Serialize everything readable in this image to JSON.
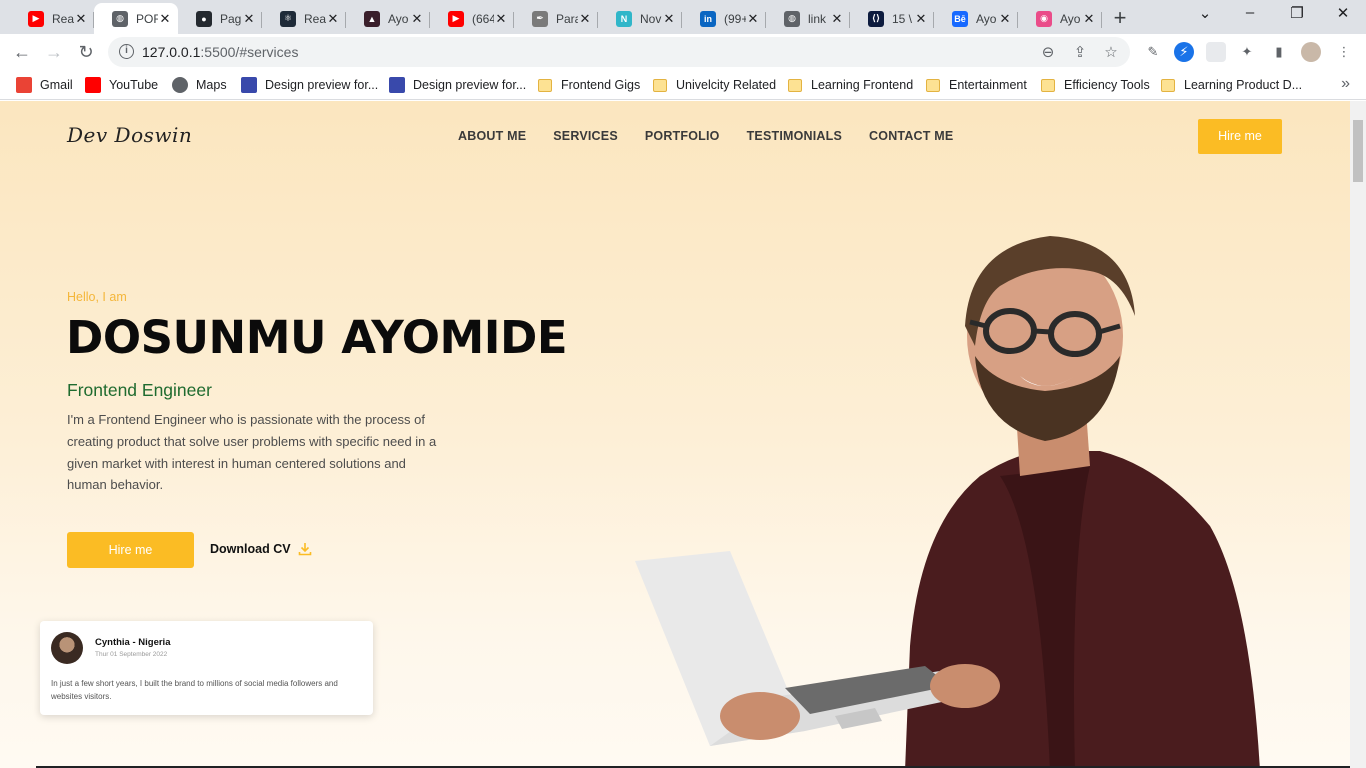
{
  "browser": {
    "tabs": [
      {
        "title": "Rea",
        "favicon": "youtube-icon",
        "color": "#ff0000"
      },
      {
        "title": "POF",
        "favicon": "globe-icon",
        "color": "#5f6368",
        "active": true
      },
      {
        "title": "Pag",
        "favicon": "github-icon",
        "color": "#24292f"
      },
      {
        "title": "Rea",
        "favicon": "react-icon",
        "color": "#1e2a38"
      },
      {
        "title": "Ayo",
        "favicon": "triangle-logo-icon",
        "color": "#3a1f2b"
      },
      {
        "title": "(664",
        "favicon": "youtube-icon",
        "color": "#ff0000"
      },
      {
        "title": "Para",
        "favicon": "feather-icon",
        "color": "#7a7a7a"
      },
      {
        "title": "Nov",
        "favicon": "n-logo-icon",
        "color": "#30b6c9"
      },
      {
        "title": "(99+",
        "favicon": "linkedin-icon",
        "color": "#0a66c2"
      },
      {
        "title": "link",
        "favicon": "globe-icon",
        "color": "#5f6368"
      },
      {
        "title": "15 \\",
        "favicon": "code-logo-icon",
        "color": "#0d1b3e"
      },
      {
        "title": "Ayo",
        "favicon": "behance-icon",
        "color": "#1769ff"
      },
      {
        "title": "Ayo",
        "favicon": "dribbble-icon",
        "color": "#ea4c89"
      }
    ],
    "url_host": "127.0.0.1",
    "url_rest": ":5500/#services",
    "bookmarks": [
      {
        "label": "Gmail",
        "icon": "gmail-icon",
        "type": "site"
      },
      {
        "label": "YouTube",
        "icon": "youtube-icon",
        "type": "site"
      },
      {
        "label": "Maps",
        "icon": "globe-icon",
        "type": "site"
      },
      {
        "label": "Design preview for...",
        "icon": "design-preview-icon",
        "type": "site"
      },
      {
        "label": "Design preview for...",
        "icon": "design-preview-icon",
        "type": "site"
      },
      {
        "label": "Frontend Gigs",
        "icon": "folder-icon",
        "type": "folder"
      },
      {
        "label": "Univelcity Related",
        "icon": "folder-icon",
        "type": "folder"
      },
      {
        "label": "Learning Frontend",
        "icon": "folder-icon",
        "type": "folder"
      },
      {
        "label": "Entertainment",
        "icon": "folder-icon",
        "type": "folder"
      },
      {
        "label": "Efficiency Tools",
        "icon": "folder-icon",
        "type": "folder"
      },
      {
        "label": "Learning Product D...",
        "icon": "folder-icon",
        "type": "folder"
      }
    ]
  },
  "site": {
    "logo": "Dev Doswin",
    "nav": [
      "ABOUT ME",
      "SERVICES",
      "PORTFOLIO",
      "TESTIMONIALS",
      "CONTACT ME"
    ],
    "hire_top": "Hire me",
    "greeting": "Hello, I am",
    "name": "DOSUNMU AYOMIDE",
    "role": "Frontend Engineer",
    "bio": "I'm a Frontend Engineer who is passionate with the process of creating product that solve user problems with specific need in a given market with interest in human centered solutions and human behavior.",
    "hire_main": "Hire me",
    "download": "Download CV",
    "testimonial": {
      "name": "Cynthia - Nigeria",
      "date": "Thur 01 September 2022",
      "text": "In just a few short years, I built the brand to millions of social media followers and websites visitors."
    },
    "colors": {
      "accent": "#fbbc24",
      "role": "#1f6b2f",
      "greeting": "#f4b63a"
    }
  }
}
